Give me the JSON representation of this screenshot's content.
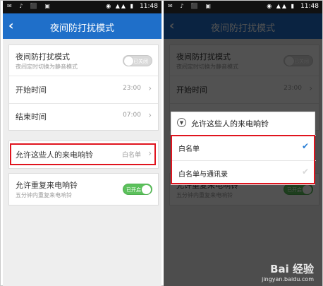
{
  "colors": {
    "appbar": "#1f6fc9",
    "highlight": "#e0141e",
    "toggle_on": "#5cc15c",
    "check": "#2a7fd6"
  },
  "status_bar": {
    "left_icons": "✉ ♪ ⬛ ▣",
    "right_icons": "◉ ▲▲ ▮",
    "time": "11:48"
  },
  "screen": {
    "back_icon": "chevron-left-icon",
    "title": "夜间防打扰模式"
  },
  "settings": {
    "night_mode": {
      "label": "夜间防打扰模式",
      "sub": "夜间定时切换为静音模式",
      "toggle": "已关闭"
    },
    "start_time": {
      "label": "开始时间",
      "value": "23:00"
    },
    "end_time": {
      "label": "结束时间",
      "value": "07:00"
    },
    "allow_calls": {
      "label": "允许这些人的来电响铃",
      "value": "白名单"
    },
    "repeat_ring": {
      "label": "允许重复来电响铃",
      "sub": "五分钟内重复来电响铃",
      "toggle": "已开启"
    }
  },
  "dialog": {
    "title": "允许这些人的来电响铃",
    "options": [
      {
        "label": "白名单",
        "checked": true
      },
      {
        "label": "白名单与通讯录",
        "checked": false
      }
    ]
  },
  "watermark": {
    "brand": "Bai 经验",
    "url": "jingyan.baidu.com"
  }
}
